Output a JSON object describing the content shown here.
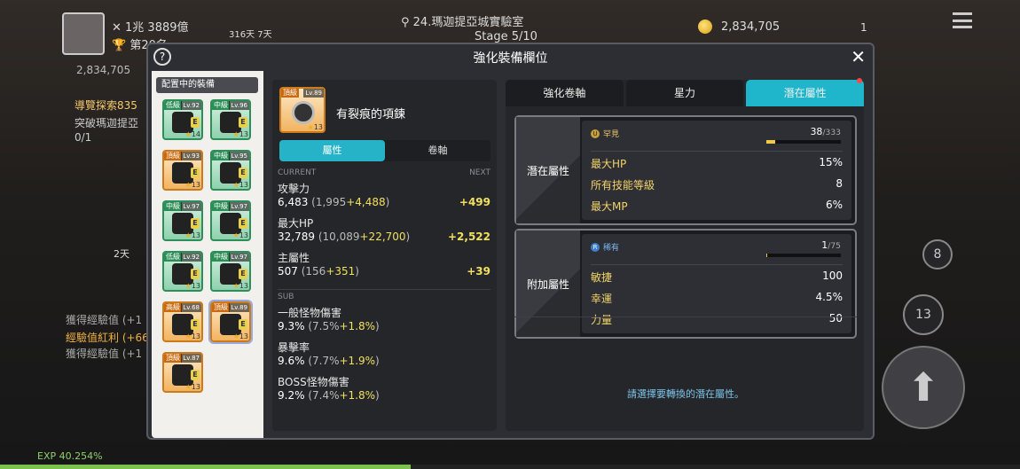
{
  "hud": {
    "power": "1兆 3889億",
    "rank": "第20名",
    "map_days": "316天 7天",
    "map_name": "24.瑪迦提亞城實驗室",
    "stage": "Stage 5/10",
    "gold": "2,834,705",
    "left_gold": "2,834,705",
    "bag_count": "1",
    "quest_title": "導覽探索835",
    "quest_desc": "突破瑪迦提亞",
    "quest_progress": "0/1",
    "days2": "2天",
    "log1": "獲得經驗值 (+1",
    "log2": "經驗值紅利 (+66",
    "log3": "獲得經驗值 (+1",
    "exp_label": "EXP",
    "exp_value": "40.254%",
    "exp_fraction": 0.40254,
    "btn_8": "8",
    "btn_13": "13"
  },
  "modal": {
    "title": "強化裝備欄位",
    "help": "?",
    "close": "✕"
  },
  "equip": {
    "title": "配置中的裝備",
    "items": [
      {
        "grade": "低級",
        "lv": "Lv.92",
        "star": "14",
        "color": "green"
      },
      {
        "grade": "中級",
        "lv": "Lv.96",
        "star": "13",
        "color": "green"
      },
      {
        "grade": "頂級",
        "lv": "Lv.93",
        "star": "13",
        "color": "orange"
      },
      {
        "grade": "中級",
        "lv": "Lv.95",
        "star": "13",
        "color": "green"
      },
      {
        "grade": "中級",
        "lv": "Lv.97",
        "star": "13",
        "color": "green"
      },
      {
        "grade": "中級",
        "lv": "Lv.97",
        "star": "13",
        "color": "green"
      },
      {
        "grade": "低級",
        "lv": "Lv.92",
        "star": "13",
        "color": "green"
      },
      {
        "grade": "中級",
        "lv": "Lv.97",
        "star": "13",
        "color": "green"
      },
      {
        "grade": "高級",
        "lv": "Lv.68",
        "star": "13",
        "color": "orange"
      },
      {
        "grade": "頂級",
        "lv": "Lv.89",
        "star": "13",
        "color": "orange"
      },
      {
        "grade": "頂級",
        "lv": "Lv.87",
        "star": "13",
        "color": "orange"
      }
    ]
  },
  "item": {
    "grade": "頂級",
    "lv": "Lv.89",
    "star": "13",
    "name": "有裂痕的項鍊",
    "tab_attr": "屬性",
    "tab_scroll": "卷軸",
    "current": "CURRENT",
    "next": "NEXT",
    "sub": "SUB",
    "stats": [
      {
        "name": "攻擊力",
        "value": "6,483",
        "base": "1,995",
        "bonus": "+4,488",
        "next": "+499"
      },
      {
        "name": "最大HP",
        "value": "32,789",
        "base": "10,089",
        "bonus": "+22,700",
        "next": "+2,522"
      },
      {
        "name": "主屬性",
        "value": "507",
        "base": "156",
        "bonus": "+351",
        "next": "+39"
      }
    ],
    "sub_stats": [
      {
        "name": "一般怪物傷害",
        "value": "9.3%",
        "base": "7.5%",
        "bonus": "+1.8%"
      },
      {
        "name": "暴擊率",
        "value": "9.6%",
        "base": "7.7%",
        "bonus": "+1.9%"
      },
      {
        "name": "BOSS怪物傷害",
        "value": "9.2%",
        "base": "7.4%",
        "bonus": "+1.8%"
      }
    ]
  },
  "tabs": [
    "強化卷軸",
    "星力",
    "潛在屬性"
  ],
  "potential": {
    "label": "潛在屬性",
    "rarity": "罕見",
    "rarity_icon": "U",
    "count": "38",
    "count_max": "/333",
    "fraction": 0.114,
    "lines": [
      {
        "name": "最大HP",
        "value": "15%"
      },
      {
        "name": "所有技能等級",
        "value": "8"
      },
      {
        "name": "最大MP",
        "value": "6%"
      }
    ]
  },
  "additional": {
    "label": "附加屬性",
    "rarity": "稀有",
    "rarity_icon": "R",
    "count": "1",
    "count_max": "/75",
    "fraction": 0.013,
    "lines": [
      {
        "name": "敏捷",
        "value": "100"
      },
      {
        "name": "幸運",
        "value": "4.5%"
      },
      {
        "name": "力量",
        "value": "50"
      }
    ]
  },
  "hint": "請選擇要轉換的潛在屬性。",
  "colors": {
    "accent": "#1fb6cc",
    "gold_text": "#f3d46a",
    "hint": "#7cc3e8"
  }
}
